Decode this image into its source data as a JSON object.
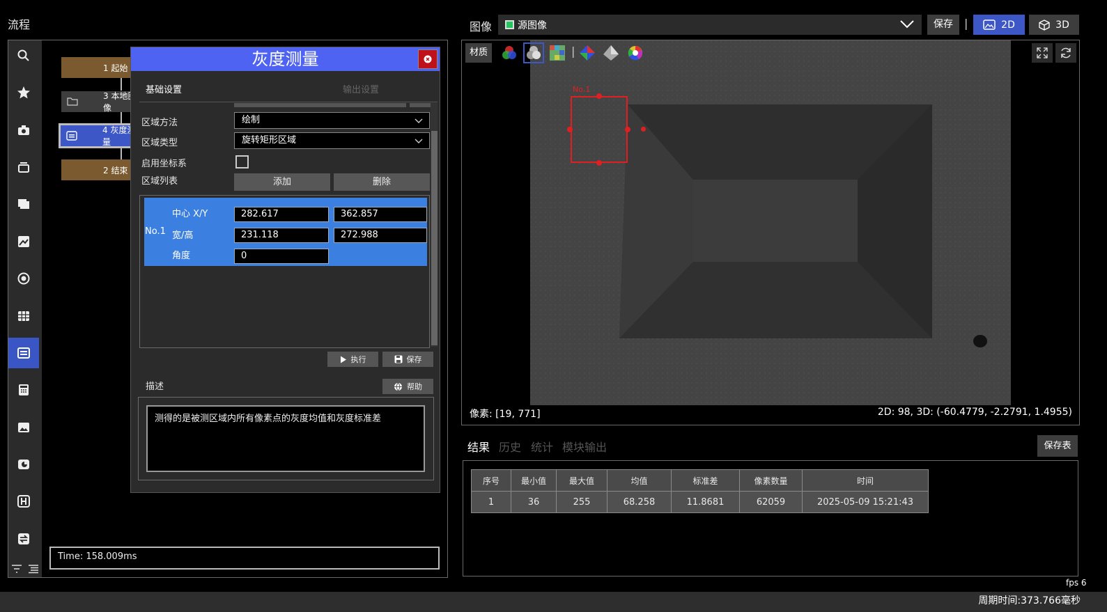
{
  "flow": {
    "title": "流程",
    "nodes": [
      "1 起始",
      "3 本地图像",
      "4 灰度测量",
      "2 结束"
    ],
    "time": "Time: 158.009ms"
  },
  "dialog": {
    "title": "灰度测量",
    "tabs": {
      "basic": "基础设置",
      "output": "输出设置"
    },
    "region_method_label": "区域方法",
    "region_method_value": "绘制",
    "region_type_label": "区域类型",
    "region_type_value": "旋转矩形区域",
    "enable_coord_label": "启用坐标系",
    "region_list_label": "区域列表",
    "add_label": "添加",
    "delete_label": "删除",
    "region": {
      "id": "No.1",
      "center_label": "中心 X/Y",
      "center_x": "282.617",
      "center_y": "362.857",
      "size_label": "宽/高",
      "width": "231.118",
      "height": "272.988",
      "angle_label": "角度",
      "angle": "0"
    },
    "execute_label": "执行",
    "save_label": "保存",
    "desc_label": "描述",
    "help_label": "帮助",
    "description": "测得的是被测区域内所有像素点的灰度均值和灰度标准差"
  },
  "image": {
    "title": "图像",
    "source": "源图像",
    "save_label": "保存",
    "separator": "|",
    "btn_2d": "2D",
    "btn_3d": "3D",
    "material_label": "材质",
    "roi_label": "No.1",
    "pixel_readout": "像素: [19, 771]",
    "value_readout": "2D: 98, 3D: (-60.4779, -2.2791, 1.4955)"
  },
  "results": {
    "tabs": [
      "结果",
      "历史",
      "统计",
      "模块输出"
    ],
    "save_table_label": "保存表",
    "columns": [
      "序号",
      "最小值",
      "最大值",
      "均值",
      "标准差",
      "像素数量",
      "时间"
    ],
    "rows": [
      [
        "1",
        "36",
        "255",
        "68.258",
        "11.8681",
        "62059",
        "2025-05-09 15:21:43"
      ]
    ]
  },
  "status": {
    "fps": "fps 6",
    "cycle": "周期时间:373.766毫秒"
  },
  "colors": {
    "accent": "#3d57c6",
    "dialog_header": "#4f63f2",
    "region_row": "#3b7fe0",
    "roi": "#e02020",
    "flow_node": "#7a5a2e",
    "close": "#c0101a"
  }
}
